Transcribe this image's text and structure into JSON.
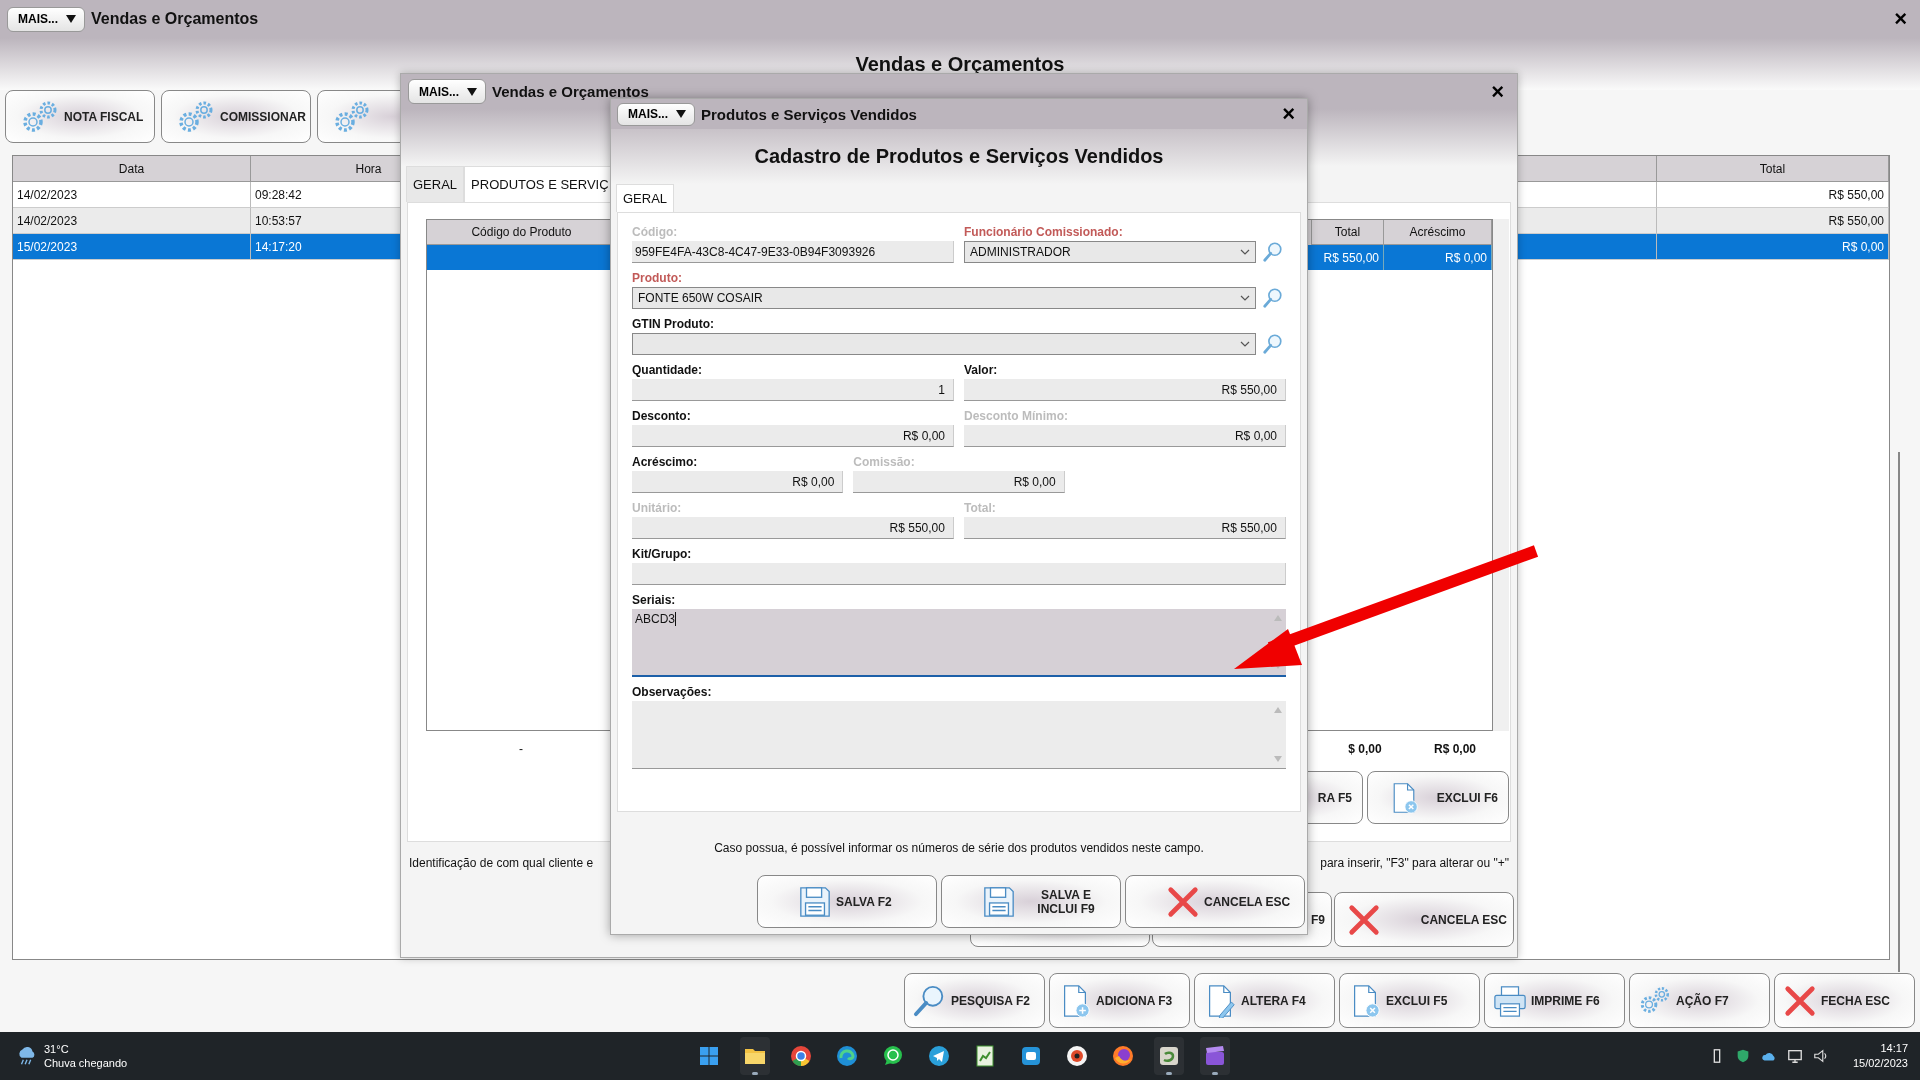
{
  "main": {
    "menu_button": "MAIS...",
    "title": "Vendas e Orçamentos",
    "close": "×",
    "heading": "Vendas e Orçamentos",
    "toolbar": [
      {
        "label": "NOTA FISCAL",
        "kind": "gears"
      },
      {
        "label": "COMISSIONAR",
        "kind": "gears"
      },
      {
        "kind": "gears"
      }
    ],
    "table": {
      "columns": [
        "Data",
        "Hora",
        "Total"
      ],
      "rows": [
        {
          "cells": [
            "14/02/2023",
            "09:28:42",
            "R$ 550,00"
          ],
          "selected": false
        },
        {
          "cells": [
            "14/02/2023",
            "10:53:57",
            "R$ 550,00"
          ],
          "selected": false
        },
        {
          "cells": [
            "15/02/2023",
            "14:17:20",
            "R$ 0,00"
          ],
          "selected": true
        }
      ]
    },
    "buttons": [
      {
        "label": "PESQUISA F2",
        "kind": "magnifier"
      },
      {
        "label": "ADICIONA F3",
        "kind": "doc-plus"
      },
      {
        "label": "ALTERA F4",
        "kind": "doc-pencil"
      },
      {
        "label": "EXCLUI F5",
        "kind": "doc-x"
      },
      {
        "label": "IMPRIME F6",
        "kind": "printer"
      },
      {
        "label": "AÇÃO F7",
        "kind": "gears"
      },
      {
        "label": "FECHA ESC",
        "kind": "cross"
      }
    ]
  },
  "window2": {
    "menu_button": "MAIS...",
    "title": "Vendas e Orçamentos",
    "close": "×",
    "tabs": [
      {
        "label": "GERAL",
        "selected": false
      },
      {
        "label": "PRODUTOS E SERVIÇ",
        "selected": true
      }
    ],
    "table": {
      "columns": [
        "Código do Produto",
        "Total",
        "Acréscimo"
      ],
      "rows": [
        {
          "cells": [
            "",
            "R$ 550,00",
            "R$ 0,00"
          ],
          "selected": true
        }
      ],
      "totals": [
        "-",
        "$ 0,00",
        "R$ 0,00"
      ]
    },
    "buttons": [
      {
        "label": "RA F5"
      },
      {
        "label": "EXCLUI F6",
        "kind": "doc-x"
      }
    ],
    "hints": [
      "Identificação de com qual cliente e",
      "para inserir, \"F3\" para alterar ou \"+\""
    ],
    "bottom_buttons": [
      {
        "kind": "floppy"
      },
      {
        "label": "F9",
        "kind": "floppy"
      },
      {
        "label": "CANCELA ESC",
        "kind": "cross"
      }
    ]
  },
  "dialog": {
    "menu_button": "MAIS...",
    "title": "Produtos e Serviços Vendidos",
    "close": "×",
    "heading": "Cadastro de Produtos e Serviços Vendidos",
    "tabs": [
      {
        "label": "GERAL",
        "selected": true
      }
    ],
    "rows": [
      [
        {
          "label": "Código:",
          "kind": "text",
          "value": "959FE4FA-43C8-4C47-9E33-0B94F3093926",
          "disabled": true,
          "required": false,
          "focused": false
        },
        {
          "label": "Funcionário Comissionado:",
          "kind": "combo",
          "value": "ADMINISTRADOR",
          "disabled": false,
          "required": true,
          "focused": false
        }
      ],
      [
        {
          "label": "Produto:",
          "kind": "combo",
          "value": "FONTE 650W COSAIR",
          "disabled": false,
          "required": true,
          "focused": false
        }
      ],
      [
        {
          "label": "GTIN Produto:",
          "kind": "combo",
          "disabled": false,
          "required": false,
          "focused": false
        }
      ],
      [
        {
          "label": "Quantidade:",
          "kind": "number",
          "value": "1",
          "disabled": false,
          "required": false,
          "focused": false
        },
        {
          "label": "Valor:",
          "kind": "number",
          "value": "R$ 550,00",
          "disabled": false,
          "required": false,
          "focused": false
        }
      ],
      [
        {
          "label": "Desconto:",
          "kind": "number",
          "value": "R$ 0,00",
          "disabled": false,
          "required": false,
          "focused": false
        },
        {
          "label": "Desconto Mínimo:",
          "kind": "number",
          "value": "R$ 0,00",
          "disabled": true,
          "required": false,
          "focused": false
        }
      ],
      [
        {
          "label": "Acréscimo:",
          "kind": "short",
          "value": "R$ 0,00",
          "disabled": false,
          "required": false,
          "focused": false
        },
        {
          "label": "Comissão:",
          "kind": "short",
          "value": "R$ 0,00",
          "disabled": true,
          "required": false,
          "focused": false
        }
      ],
      [
        {
          "label": "Unitário:",
          "kind": "number",
          "value": "R$ 550,00",
          "disabled": true,
          "required": false,
          "focused": false
        },
        {
          "label": "Total:",
          "kind": "number",
          "value": "R$ 550,00",
          "disabled": true,
          "required": false,
          "focused": false
        }
      ],
      [
        {
          "label": "Kit/Grupo:",
          "kind": "text",
          "disabled": false,
          "required": false,
          "focused": false
        }
      ],
      [
        {
          "label": "Seriais:",
          "kind": "memo",
          "value": "ABCD3",
          "disabled": false,
          "required": false,
          "focused": true
        }
      ],
      [
        {
          "label": "Observações:",
          "kind": "memo",
          "disabled": false,
          "required": false,
          "focused": false
        }
      ]
    ],
    "hint": "Caso possua, é possível informar os números de série dos produtos vendidos neste campo.",
    "buttons": [
      {
        "label": "SALVA F2",
        "kind": "floppy"
      },
      {
        "label": "SALVA E INCLUI F9",
        "kind": "floppy"
      },
      {
        "label": "CANCELA ESC",
        "kind": "cross"
      }
    ]
  },
  "taskbar": {
    "temperature": "31°C",
    "weather": "Chuva chegando",
    "apps": [
      {
        "kind": "grid",
        "running": false
      },
      {
        "kind": "folder",
        "running": true
      },
      {
        "kind": "chrome",
        "running": false
      },
      {
        "kind": "edge",
        "running": false
      },
      {
        "kind": "chat",
        "running": false
      },
      {
        "kind": "plane",
        "running": false
      },
      {
        "kind": "sheet",
        "running": false
      },
      {
        "kind": "square",
        "running": false
      },
      {
        "kind": "badge",
        "running": false
      },
      {
        "kind": "fox",
        "running": false
      },
      {
        "kind": "swirl",
        "running": true
      },
      {
        "kind": "clapper",
        "running": true
      }
    ],
    "tray": [
      {
        "kind": "usb"
      },
      {
        "kind": "shield"
      },
      {
        "kind": "cloud"
      },
      {
        "kind": "monitor"
      },
      {
        "kind": "speaker"
      }
    ],
    "time": "14:17",
    "date": "15/02/2023"
  }
}
